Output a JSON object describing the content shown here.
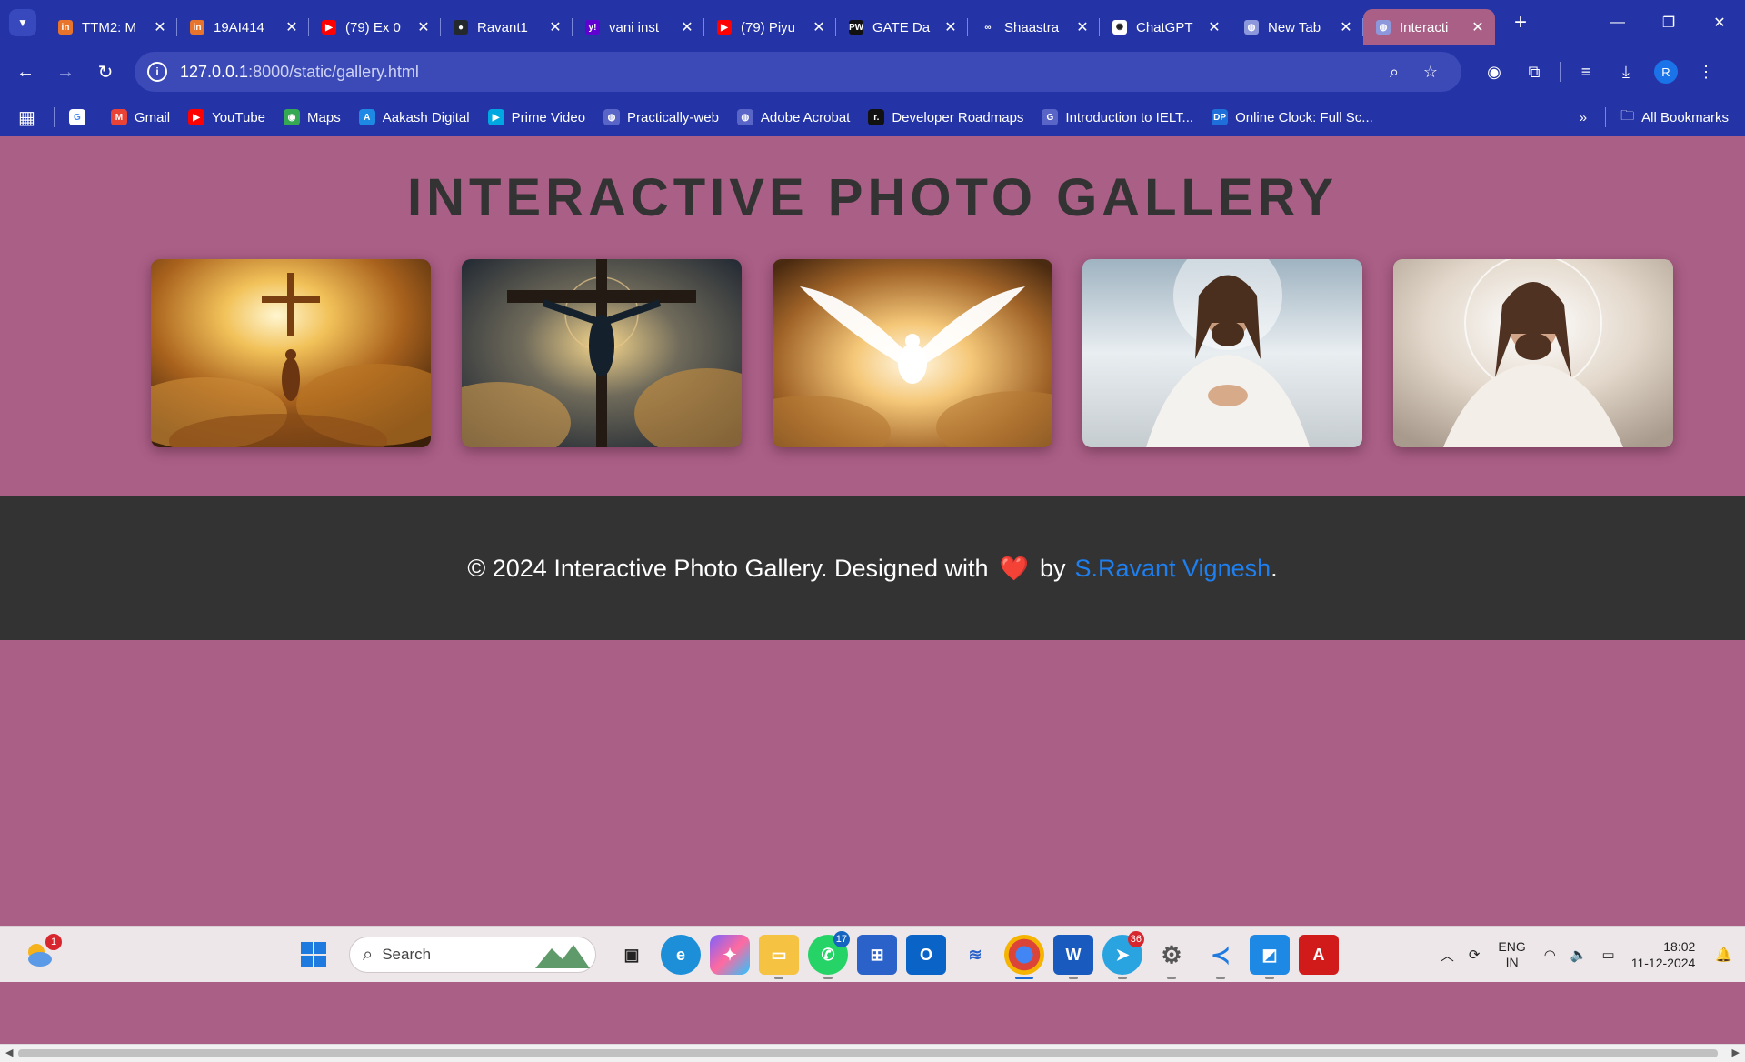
{
  "browser": {
    "tabs": [
      {
        "title": "TTM2: M",
        "favicon_color": "#e8742c",
        "favicon_text": "in"
      },
      {
        "title": "19AI414",
        "favicon_color": "#e8742c",
        "favicon_text": "in"
      },
      {
        "title": "(79) Ex 0",
        "favicon_color": "#ff0000",
        "favicon_text": "▶"
      },
      {
        "title": "Ravant1",
        "favicon_color": "#24292e",
        "favicon_text": "●"
      },
      {
        "title": "vani inst",
        "favicon_color": "#6001d2",
        "favicon_text": "y!"
      },
      {
        "title": "(79) Piyu",
        "favicon_color": "#ff0000",
        "favicon_text": "▶"
      },
      {
        "title": "GATE Da",
        "favicon_color": "#111111",
        "favicon_text": "PW"
      },
      {
        "title": "Shaastra",
        "favicon_color": "#2434a6",
        "favicon_text": "∞"
      },
      {
        "title": "ChatGPT",
        "favicon_color": "#ffffff",
        "favicon_text": "✺"
      },
      {
        "title": "New Tab",
        "favicon_color": "#8d97dc",
        "favicon_text": "◍"
      },
      {
        "title": "Interacti",
        "favicon_color": "#8d97dc",
        "favicon_text": "◍"
      }
    ],
    "active_tab_index": 10,
    "url_host": "127.0.0.1",
    "url_path": ":8000/static/gallery.html",
    "profile_initial": "R",
    "bookmarks": [
      {
        "label": "",
        "icon": "G",
        "color": "#ffffff"
      },
      {
        "label": "Gmail",
        "icon": "M",
        "color": "#ea4335"
      },
      {
        "label": "YouTube",
        "icon": "▶",
        "color": "#ff0000"
      },
      {
        "label": "Maps",
        "icon": "◉",
        "color": "#34a853"
      },
      {
        "label": "Aakash Digital",
        "icon": "A",
        "color": "#1e88e5"
      },
      {
        "label": "Prime Video",
        "icon": "▶",
        "color": "#00a8e1"
      },
      {
        "label": "Practically-web",
        "icon": "◍",
        "color": "#5a66c7"
      },
      {
        "label": "Adobe Acrobat",
        "icon": "◍",
        "color": "#5a66c7"
      },
      {
        "label": "Developer Roadmaps",
        "icon": "r.",
        "color": "#111111"
      },
      {
        "label": "Introduction to IELT...",
        "icon": "G",
        "color": "#5a66c7"
      },
      {
        "label": "Online Clock: Full Sc...",
        "icon": "DP",
        "color": "#1e6fd9"
      }
    ],
    "all_bookmarks_label": "All Bookmarks"
  },
  "page": {
    "title": "INTERACTIVE PHOTO GALLERY",
    "footer_text": "© 2024 Interactive Photo Gallery. Designed with",
    "footer_by": "by",
    "footer_author": "S.Ravant Vignesh",
    "footer_end": "."
  },
  "taskbar": {
    "search_placeholder": "Search",
    "weather_badge": "1",
    "whatsapp_badge": "17",
    "telegram_badge": "36",
    "lang_line1": "ENG",
    "lang_line2": "IN",
    "time": "18:02",
    "date": "11-12-2024"
  }
}
